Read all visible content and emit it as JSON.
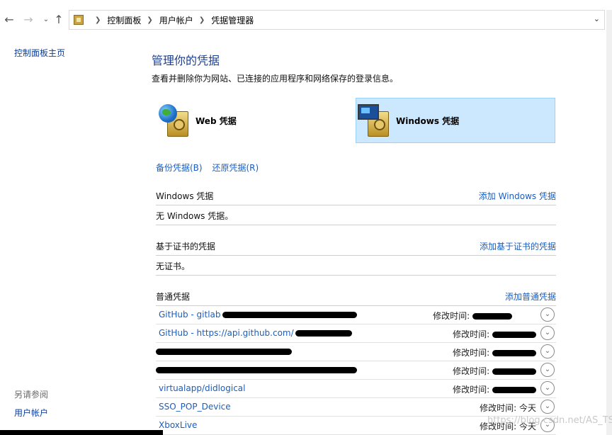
{
  "address": {
    "back_icon": "arrow-left-icon",
    "forward_icon": "arrow-right-icon",
    "recent_icon": "chevron-down-icon",
    "up_icon": "arrow-up-icon",
    "crumbs": [
      "控制面板",
      "用户帐户",
      "凭据管理器"
    ]
  },
  "leftnav": {
    "home": "控制面板主页",
    "see_also": "另请参阅",
    "user_accounts": "用户帐户"
  },
  "main": {
    "title": "管理你的凭据",
    "subtitle": "查看并删除你为网站、已连接的应用程序和网络保存的登录信息。",
    "web_label": "Web 凭据",
    "windows_label": "Windows 凭据",
    "backup": "备份凭据(B)",
    "restore": "还原凭据(R)"
  },
  "sections": {
    "windows": {
      "title": "Windows 凭据",
      "add": "添加 Windows 凭据",
      "empty": "无 Windows 凭据。"
    },
    "cert": {
      "title": "基于证书的凭据",
      "add": "添加基于证书的凭据",
      "empty": "无证书。"
    },
    "generic": {
      "title": "普通凭据",
      "add": "添加普通凭据",
      "modified_label": "修改时间:",
      "rows": [
        {
          "name": "GitHub - gitlab",
          "value": ""
        },
        {
          "name": "GitHub - https://api.github.com/",
          "value": ""
        },
        {
          "name": "",
          "value": ""
        },
        {
          "name": "",
          "value": ""
        },
        {
          "name": "virtualapp/didlogical",
          "value": ""
        },
        {
          "name": "SSO_POP_Device",
          "value": "今天"
        },
        {
          "name": "XboxLive",
          "value": "今天"
        }
      ]
    }
  },
  "watermark": "https://blog.csdn.net/AS_TS"
}
